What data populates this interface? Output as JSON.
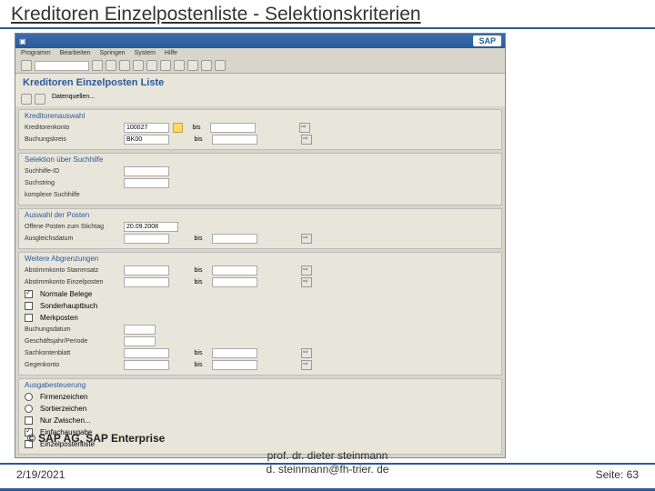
{
  "slide": {
    "title": "Kreditoren Einzelpostenliste - Selektionskriterien"
  },
  "sap": {
    "logo": "SAP",
    "menu": [
      "Programm",
      "Bearbeiten",
      "Springen",
      "System",
      "Hilfe"
    ],
    "screen_title": "Kreditoren Einzelposten Liste",
    "datenquellen": "Datenquellen..."
  },
  "g1": {
    "title": "Kreditorenauswahl",
    "r1_lbl": "Kreditorenkonto",
    "r1_val": "100027",
    "bis": "bis",
    "r2_lbl": "Buchungskreis",
    "r2_val": "BK00"
  },
  "g2": {
    "title": "Selektion über Suchhilfe",
    "r1": "Suchhilfe-ID",
    "r2": "Suchstring",
    "r3": "komplexe Suchhilfe"
  },
  "g3": {
    "title": "Auswahl der Posten",
    "r1_lbl": "Offene Posten zum Stichtag",
    "r1_val": "20.09.2008",
    "r2_lbl": "Ausgleichsdatum",
    "bis": "bis"
  },
  "g4": {
    "title": "Weitere Abgrenzungen",
    "r1": "Abstimmkonto Stammsatz",
    "r2": "Abstimmkonto Einzelposten",
    "c1": "Normale Belege",
    "c2": "Sonderhauptbuch",
    "c3": "Merkposten",
    "r3": "Buchungsdatum",
    "r4": "Geschäftsjahr/Periode",
    "r5": "Sachkontenblatt",
    "r6": "Gegenkonto",
    "bis": "bis"
  },
  "g5": {
    "title": "Ausgabesteuerung",
    "c1": "Firmenzeichen",
    "c2": "Sortierzeichen",
    "c3": "Nur Zwischen...",
    "c4": "Einfachausgabe",
    "c5": "Einzelpostenliste"
  },
  "copyright": "© SAP AG, SAP Enterprise",
  "footer": {
    "date": "2/19/2021",
    "name": "prof. dr. dieter steinmann",
    "email": "d. steinmann@fh-trier. de",
    "page": "Seite: 63"
  }
}
